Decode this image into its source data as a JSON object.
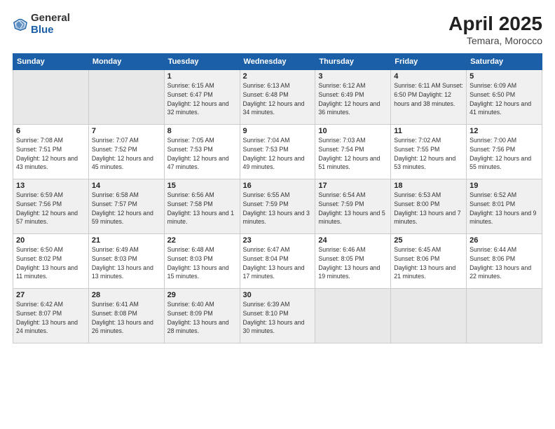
{
  "logo": {
    "general": "General",
    "blue": "Blue"
  },
  "title": "April 2025",
  "location": "Temara, Morocco",
  "days_header": [
    "Sunday",
    "Monday",
    "Tuesday",
    "Wednesday",
    "Thursday",
    "Friday",
    "Saturday"
  ],
  "weeks": [
    [
      {
        "day": "",
        "info": ""
      },
      {
        "day": "",
        "info": ""
      },
      {
        "day": "1",
        "info": "Sunrise: 6:15 AM\nSunset: 6:47 PM\nDaylight: 12 hours\nand 32 minutes."
      },
      {
        "day": "2",
        "info": "Sunrise: 6:13 AM\nSunset: 6:48 PM\nDaylight: 12 hours\nand 34 minutes."
      },
      {
        "day": "3",
        "info": "Sunrise: 6:12 AM\nSunset: 6:49 PM\nDaylight: 12 hours\nand 36 minutes."
      },
      {
        "day": "4",
        "info": "Sunrise: 6:11 AM\nSunset: 6:50 PM\nDaylight: 12 hours\nand 38 minutes."
      },
      {
        "day": "5",
        "info": "Sunrise: 6:09 AM\nSunset: 6:50 PM\nDaylight: 12 hours\nand 41 minutes."
      }
    ],
    [
      {
        "day": "6",
        "info": "Sunrise: 7:08 AM\nSunset: 7:51 PM\nDaylight: 12 hours\nand 43 minutes."
      },
      {
        "day": "7",
        "info": "Sunrise: 7:07 AM\nSunset: 7:52 PM\nDaylight: 12 hours\nand 45 minutes."
      },
      {
        "day": "8",
        "info": "Sunrise: 7:05 AM\nSunset: 7:53 PM\nDaylight: 12 hours\nand 47 minutes."
      },
      {
        "day": "9",
        "info": "Sunrise: 7:04 AM\nSunset: 7:53 PM\nDaylight: 12 hours\nand 49 minutes."
      },
      {
        "day": "10",
        "info": "Sunrise: 7:03 AM\nSunset: 7:54 PM\nDaylight: 12 hours\nand 51 minutes."
      },
      {
        "day": "11",
        "info": "Sunrise: 7:02 AM\nSunset: 7:55 PM\nDaylight: 12 hours\nand 53 minutes."
      },
      {
        "day": "12",
        "info": "Sunrise: 7:00 AM\nSunset: 7:56 PM\nDaylight: 12 hours\nand 55 minutes."
      }
    ],
    [
      {
        "day": "13",
        "info": "Sunrise: 6:59 AM\nSunset: 7:56 PM\nDaylight: 12 hours\nand 57 minutes."
      },
      {
        "day": "14",
        "info": "Sunrise: 6:58 AM\nSunset: 7:57 PM\nDaylight: 12 hours\nand 59 minutes."
      },
      {
        "day": "15",
        "info": "Sunrise: 6:56 AM\nSunset: 7:58 PM\nDaylight: 13 hours\nand 1 minute."
      },
      {
        "day": "16",
        "info": "Sunrise: 6:55 AM\nSunset: 7:59 PM\nDaylight: 13 hours\nand 3 minutes."
      },
      {
        "day": "17",
        "info": "Sunrise: 6:54 AM\nSunset: 7:59 PM\nDaylight: 13 hours\nand 5 minutes."
      },
      {
        "day": "18",
        "info": "Sunrise: 6:53 AM\nSunset: 8:00 PM\nDaylight: 13 hours\nand 7 minutes."
      },
      {
        "day": "19",
        "info": "Sunrise: 6:52 AM\nSunset: 8:01 PM\nDaylight: 13 hours\nand 9 minutes."
      }
    ],
    [
      {
        "day": "20",
        "info": "Sunrise: 6:50 AM\nSunset: 8:02 PM\nDaylight: 13 hours\nand 11 minutes."
      },
      {
        "day": "21",
        "info": "Sunrise: 6:49 AM\nSunset: 8:03 PM\nDaylight: 13 hours\nand 13 minutes."
      },
      {
        "day": "22",
        "info": "Sunrise: 6:48 AM\nSunset: 8:03 PM\nDaylight: 13 hours\nand 15 minutes."
      },
      {
        "day": "23",
        "info": "Sunrise: 6:47 AM\nSunset: 8:04 PM\nDaylight: 13 hours\nand 17 minutes."
      },
      {
        "day": "24",
        "info": "Sunrise: 6:46 AM\nSunset: 8:05 PM\nDaylight: 13 hours\nand 19 minutes."
      },
      {
        "day": "25",
        "info": "Sunrise: 6:45 AM\nSunset: 8:06 PM\nDaylight: 13 hours\nand 21 minutes."
      },
      {
        "day": "26",
        "info": "Sunrise: 6:44 AM\nSunset: 8:06 PM\nDaylight: 13 hours\nand 22 minutes."
      }
    ],
    [
      {
        "day": "27",
        "info": "Sunrise: 6:42 AM\nSunset: 8:07 PM\nDaylight: 13 hours\nand 24 minutes."
      },
      {
        "day": "28",
        "info": "Sunrise: 6:41 AM\nSunset: 8:08 PM\nDaylight: 13 hours\nand 26 minutes."
      },
      {
        "day": "29",
        "info": "Sunrise: 6:40 AM\nSunset: 8:09 PM\nDaylight: 13 hours\nand 28 minutes."
      },
      {
        "day": "30",
        "info": "Sunrise: 6:39 AM\nSunset: 8:10 PM\nDaylight: 13 hours\nand 30 minutes."
      },
      {
        "day": "",
        "info": ""
      },
      {
        "day": "",
        "info": ""
      },
      {
        "day": "",
        "info": ""
      }
    ]
  ]
}
